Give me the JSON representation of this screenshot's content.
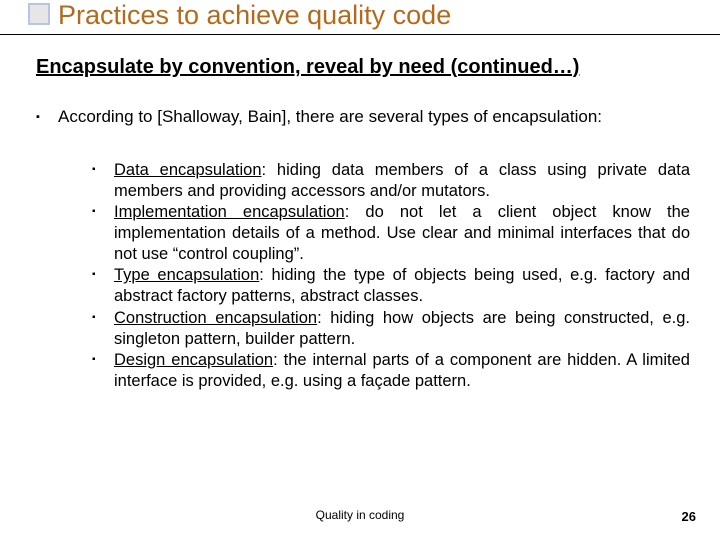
{
  "title": "Practices to achieve quality code",
  "subtitle": "Encapsulate by convention, reveal by need (continued…)",
  "intro": "According to [Shalloway, Bain], there are several types of encapsulation:",
  "items": [
    {
      "term": "Data encapsulation",
      "rest": ": hiding data members of a class using private data members and providing accessors and/or mutators."
    },
    {
      "term": "Implementation encapsulation",
      "rest": ": do not let a client object know the implementation details of a method. Use clear and minimal interfaces that do not use “control coupling”."
    },
    {
      "term": "Type encapsulation",
      "rest": ": hiding the type of objects being used, e.g. factory and abstract factory patterns, abstract classes."
    },
    {
      "term": "Construction encapsulation",
      "rest": ": hiding how objects are being constructed, e.g. singleton pattern, builder pattern."
    },
    {
      "term": "Design encapsulation",
      "rest": ": the internal parts of a component are hidden. A limited interface is provided, e.g. using a façade pattern."
    }
  ],
  "footer_center": "Quality in coding",
  "page_number": "26"
}
